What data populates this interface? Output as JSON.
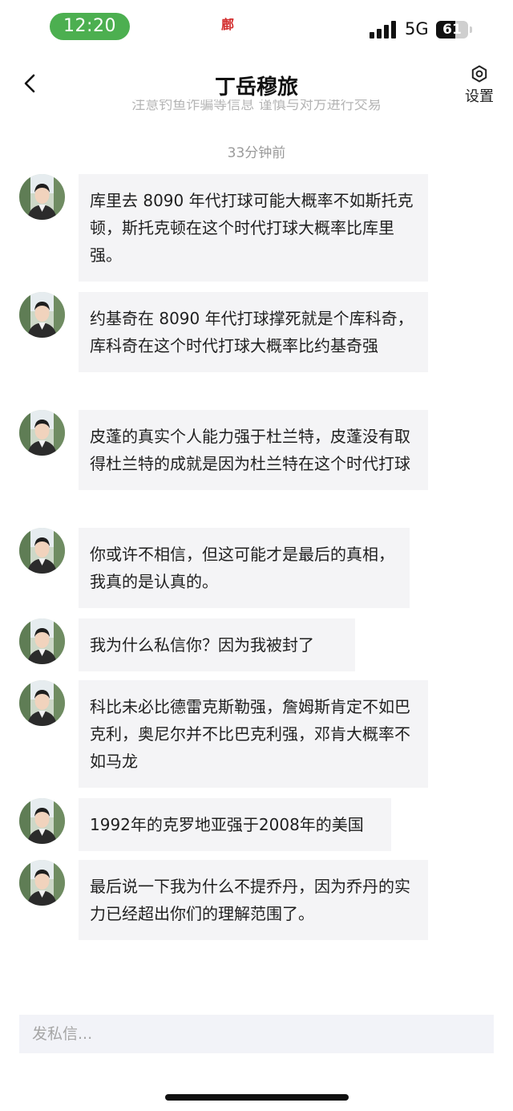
{
  "status_bar": {
    "time": "12:20",
    "center_mark": "鄜",
    "network": "5G",
    "battery": "61",
    "battery_level": 0.61
  },
  "header": {
    "title": "丁岳穆旅",
    "settings_label": "设置",
    "clipped_notice": "注意钓鱼诈骗等信息 谨慎与对方进行交易"
  },
  "timestamp": "33分钟前",
  "messages": [
    {
      "text": "库里去 8090 年代打球可能大概率不如斯托克顿，斯托克顿在这个时代打球大概率比库里强。"
    },
    {
      "text": "约基奇在 8090 年代打球撑死就是个库科奇，库科奇在这个时代打球大概率比约基奇强"
    },
    {
      "text": "皮蓬的真实个人能力强于杜兰特，皮蓬没有取得杜兰特的成就是因为杜兰特在这个时代打球"
    },
    {
      "text": "你或许不相信，但这可能才是最后的真相，我真的是认真的。"
    },
    {
      "text": "我为什么私信你？因为我被封了"
    },
    {
      "text": "科比未必比德雷克斯勒强，詹姆斯肯定不如巴克利，奥尼尔并不比巴克利强，邓肯大概率不如马龙"
    },
    {
      "text": "1992年的克罗地亚强于2008年的美国"
    },
    {
      "text": "最后说一下我为什么不提乔丹，因为乔丹的实力已经超出你们的理解范围了。"
    }
  ],
  "composer": {
    "placeholder": "发私信..."
  }
}
